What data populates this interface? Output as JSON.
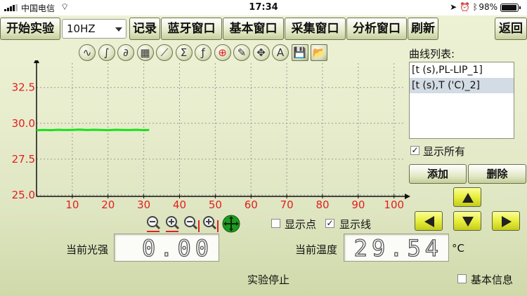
{
  "status_bar": {
    "carrier": "中国电信",
    "time": "17:34",
    "battery_pct": "98%",
    "battery_level": 0.98
  },
  "toolbar": {
    "start_label": "开始实验",
    "freq_value": "10HZ",
    "record_label": "记录",
    "bluetooth_label": "蓝牙窗口",
    "basic_label": "基本窗口",
    "collect_label": "采集窗口",
    "analysis_label": "分析窗口",
    "refresh_label": "刷新",
    "back_label": "返回"
  },
  "tools": {
    "icons": [
      "sine-wave-icon",
      "integral-icon",
      "partial-icon",
      "chip-icon",
      "curve-fit-icon",
      "sigma-icon",
      "function-icon",
      "crosshair-icon",
      "pen-icon",
      "move-icon",
      "text-a-icon",
      "save-icon",
      "open-folder-icon"
    ],
    "glyphs": [
      "∿",
      "∫",
      "∂",
      "▦",
      "⟋",
      "Σ",
      "ƒ",
      "⊕",
      "✎",
      "✥",
      "A",
      "💾",
      "📂"
    ]
  },
  "chart_data": {
    "type": "line",
    "x_ticks": [
      "10",
      "20",
      "30",
      "40",
      "50",
      "60",
      "70",
      "80",
      "90",
      "100"
    ],
    "y_ticks": [
      "25.0",
      "27.5",
      "30.0",
      "32.5"
    ],
    "xlim": [
      0,
      103
    ],
    "ylim": [
      24.9,
      34.2
    ],
    "grid": true,
    "series": [
      {
        "color": "#17e117",
        "x": [
          0,
          2,
          4,
          6,
          8,
          10,
          12,
          14,
          16,
          18,
          20,
          22,
          24,
          26,
          28,
          30,
          31.5
        ],
        "y": [
          29.51,
          29.54,
          29.52,
          29.55,
          29.53,
          29.54,
          29.56,
          29.53,
          29.55,
          29.54,
          29.52,
          29.55,
          29.54,
          29.53,
          29.55,
          29.52,
          29.54
        ]
      }
    ],
    "colors": {
      "tick_y": "#e02020",
      "tick_x": "#e02020",
      "axis": "#111111",
      "grid": "#9a9a9a"
    }
  },
  "right_panel": {
    "curve_list_title": "曲线列表:",
    "curves": [
      "[t (s),PL-LIP_1]",
      "[t (s),T ('C)_2]"
    ],
    "selected_index": 1,
    "show_all_label": "显示所有",
    "show_all_checked": true,
    "add_label": "添加",
    "delete_label": "删除"
  },
  "display_options": {
    "show_points_label": "显示点",
    "show_points_checked": false,
    "show_line_label": "显示线",
    "show_line_checked": true
  },
  "readouts": {
    "light_label": "当前光强",
    "light_value": "0.00",
    "temp_label": "当前温度",
    "temp_value": "29.54",
    "temp_unit": "°C"
  },
  "footer": {
    "status": "实验停止",
    "basic_info_label": "基本信息",
    "basic_info_checked": false
  }
}
